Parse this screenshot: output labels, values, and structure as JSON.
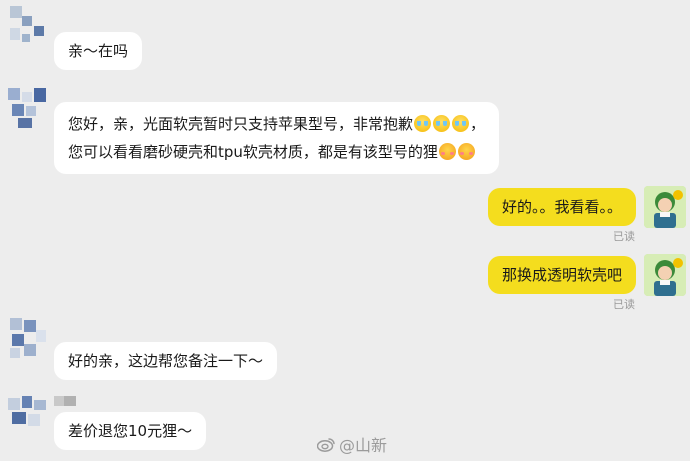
{
  "messages": [
    {
      "side": "in",
      "text": "亲～在吗"
    },
    {
      "side": "in",
      "line1": "您好，亲，光面软壳暂时只支持苹果型号，非常抱歉",
      "line1_end": "，",
      "line2": "您可以看看磨砂硬壳和tpu软壳材质，都是有该型号的狸"
    },
    {
      "side": "out",
      "text": "好的。。我看看。。",
      "status": "已读"
    },
    {
      "side": "out",
      "text": "那换成透明软壳吧",
      "status": "已读"
    },
    {
      "side": "in",
      "text": "好的亲，这边帮您备注一下～"
    },
    {
      "side": "in",
      "text": "差价退您10元狸～"
    }
  ],
  "watermark": {
    "text": "@山新"
  },
  "icons": {
    "cry": "crying-face-emoji",
    "shy": "blushing-face-emoji",
    "weibo": "weibo-logo-icon"
  },
  "colors": {
    "background": "#ededed",
    "incoming_bubble": "#ffffff",
    "outgoing_bubble": "#f4dd1e",
    "status_text": "#9a9a9a"
  }
}
